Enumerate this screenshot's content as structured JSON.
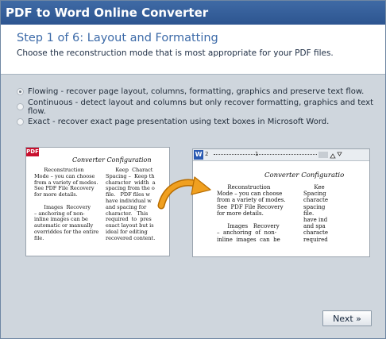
{
  "window": {
    "title": "PDF to Word Online Converter"
  },
  "header": {
    "step_title": "Step 1 of 6: Layout and Formatting",
    "description": "Choose the reconstruction mode that is most appropriate for your PDF files."
  },
  "options": [
    {
      "label": "Flowing - recover page layout, columns, formatting, graphics and preserve text flow.",
      "selected": true
    },
    {
      "label": "Continuous - detect layout and columns but only recover formatting, graphics and text flow.",
      "selected": false
    },
    {
      "label": "Exact - recover exact page presentation using text boxes in Microsoft Word.",
      "selected": false
    }
  ],
  "pdf_preview": {
    "badge": "PDF",
    "title": "Converter Configuration",
    "col1": "      Reconstruction\nMode – you can choose\nfrom a variety of modes.\nSee PDF File Recovery\nfor more details.\n\n      Images  Recovery\n– anchoring of non-\ninline images can be\nautomatic or manually\noverriddes for the entire\nfile.",
    "col2": "      Keep  Charact\nSpacing –  Keep th\ncharacter  width  a\nspacing from the o\nfile.   PDF files w\nhave individual w\nand spacing for\ncharacter.   This\nrequired  to  pres\nexact layout but is\nideal for editing\nrecovered content."
  },
  "word_preview": {
    "badge": "W",
    "ruler_left": "2",
    "ruler_mid": "1",
    "title": "Converter Configuratio",
    "col1": "      Reconstruction\nMode – you can choose\nfrom a variety of modes.\nSee  PDF File Recovery\nfor more details.\n\n      Images   Recovery\n–  anchoring  of  non-\ninline  images  can  be",
    "col2": "      Kee\nSpacing\ncharacte\nspacing\nfile.\nhave ind\nand spa\ncharacte\nrequired"
  },
  "footer": {
    "next_label": "Next »"
  },
  "colors": {
    "title_bar": "#2d5590",
    "step_title": "#3c6aa8",
    "arrow": "#f0a020",
    "pdf_badge": "#c8102e",
    "word_badge": "#2a5ab2"
  }
}
